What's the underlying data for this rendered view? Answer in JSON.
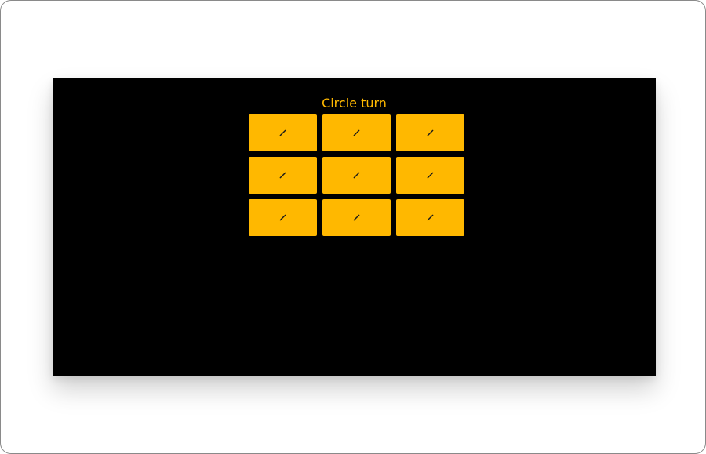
{
  "game": {
    "status": "Circle turn",
    "board": [
      {
        "id": "cell-1",
        "icon": "pencil-icon",
        "value": ""
      },
      {
        "id": "cell-2",
        "icon": "pencil-icon",
        "value": ""
      },
      {
        "id": "cell-3",
        "icon": "pencil-icon",
        "value": ""
      },
      {
        "id": "cell-4",
        "icon": "pencil-icon",
        "value": ""
      },
      {
        "id": "cell-5",
        "icon": "pencil-icon",
        "value": ""
      },
      {
        "id": "cell-6",
        "icon": "pencil-icon",
        "value": ""
      },
      {
        "id": "cell-7",
        "icon": "pencil-icon",
        "value": ""
      },
      {
        "id": "cell-8",
        "icon": "pencil-icon",
        "value": ""
      },
      {
        "id": "cell-9",
        "icon": "pencil-icon",
        "value": ""
      }
    ]
  },
  "colors": {
    "background": "#000000",
    "accent": "#ffb800",
    "icon": "#1a1a1a"
  }
}
